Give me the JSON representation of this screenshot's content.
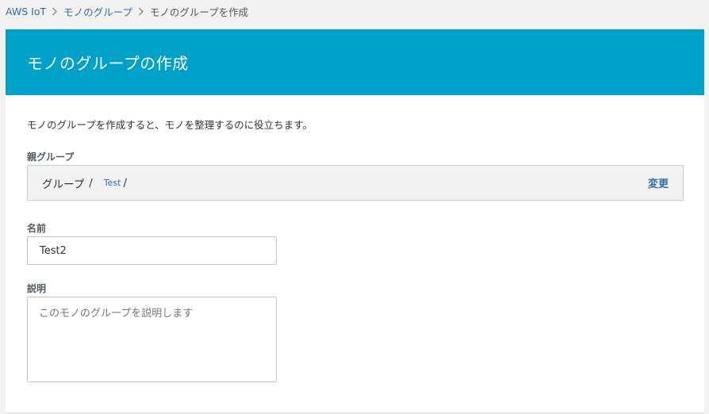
{
  "breadcrumb": {
    "items": [
      "AWS IoT",
      "モノのグループ"
    ],
    "current": "モノのグループを作成"
  },
  "header": {
    "title": "モノのグループの作成"
  },
  "form": {
    "description_text": "モノのグループを作成すると、モノを整理するのに役立ちます。",
    "parent_group": {
      "label": "親グループ",
      "root": "グループ",
      "separator": "/",
      "child": "Test",
      "change_label": "変更"
    },
    "name": {
      "label": "名前",
      "value": "Test2"
    },
    "description": {
      "label": "説明",
      "placeholder": "このモノのグループを説明します"
    }
  },
  "colors": {
    "header_bg": "#00a1c9",
    "link": "#2f6ea9"
  }
}
